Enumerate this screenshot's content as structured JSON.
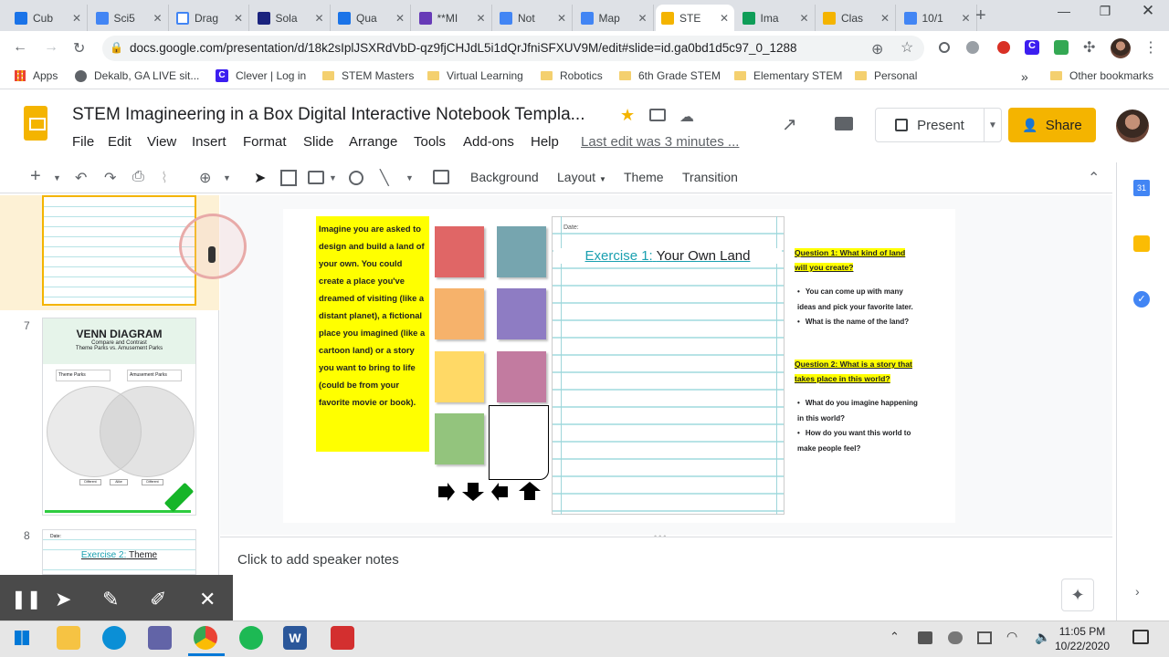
{
  "browser": {
    "tabs": [
      {
        "label": "Cub",
        "color": "#1a73e8",
        "icon": "docs-icon"
      },
      {
        "label": "Sci5",
        "color": "#4285f4",
        "icon": "docs-icon"
      },
      {
        "label": "Drag",
        "color": "#ffffff",
        "icon": "google-icon"
      },
      {
        "label": "Sola",
        "color": "#1a237e",
        "icon": "eu-flag-icon"
      },
      {
        "label": "Qua",
        "color": "#1a73e8",
        "icon": "portrait-icon"
      },
      {
        "label": "**MI",
        "color": "#673ab7",
        "icon": "forms-icon"
      },
      {
        "label": "Not",
        "color": "#4285f4",
        "icon": "docs-icon"
      },
      {
        "label": "Map",
        "color": "#4285f4",
        "icon": "docs-icon"
      },
      {
        "label": "STE",
        "color": "#f4b400",
        "icon": "slides-icon"
      },
      {
        "label": "Ima",
        "color": "#0f9d58",
        "icon": "check-icon"
      },
      {
        "label": "Clas",
        "color": "#f4b400",
        "icon": "classroom-icon"
      },
      {
        "label": "10/1",
        "color": "#4285f4",
        "icon": "docs-icon"
      }
    ],
    "url": "docs.google.com/presentation/d/18k2sIplJSXRdVbD-qz9fjCHJdL5i1dQrJfniSFXUV9M/edit#slide=id.ga0bd1d5c97_0_1288",
    "bookmarks": [
      "Apps",
      "Dekalb, GA LIVE sit...",
      "Clever | Log in",
      "STEM Masters",
      "Virtual Learning",
      "Robotics",
      "6th Grade STEM",
      "Elementary STEM",
      "Personal"
    ],
    "other_bookmarks": "Other bookmarks",
    "overflow": "»"
  },
  "doc": {
    "title": "STEM Imagineering in a Box Digital Interactive Notebook Templa...",
    "menus": [
      "File",
      "Edit",
      "View",
      "Insert",
      "Format",
      "Slide",
      "Arrange",
      "Tools",
      "Add-ons",
      "Help"
    ],
    "last_edit": "Last edit was 3 minutes ...",
    "present": "Present",
    "share": "Share"
  },
  "toolbar": {
    "background": "Background",
    "layout": "Layout",
    "theme": "Theme",
    "transition": "Transition"
  },
  "filmstrip": {
    "slide7_num": "7",
    "slide7_title": "Venn Diagram",
    "slide7_sub1": "Compare and Contrast",
    "slide7_sub2": "Theme Parks vs. Amusement Parks",
    "slide7_label1": "Theme Parks",
    "slide7_label2": "Amusement Parks",
    "slide7_boxes": [
      "Different",
      "Alike",
      "Different"
    ],
    "slide8_num": "8",
    "slide8_date": "Date:",
    "slide8_title_a": "Exercise 2:",
    "slide8_title_b": "Theme"
  },
  "slide": {
    "prompt": "Imagine you are asked to design and build a land of your own. You could create a place you've dreamed of visiting (like a distant planet), a fictional place you imagined (like a cartoon land) or a story you want to bring to life (could be from your favorite movie or book).",
    "stickies": [
      "#e06666",
      "#76a5af",
      "#f6b26b",
      "#8e7cc3",
      "#ffd966",
      "#c27ba0",
      "#93c47d"
    ],
    "date": "Date:",
    "exercise_a": "Exercise 1:",
    "exercise_b": "Your Own Land",
    "q1": "Question 1: What kind of land will you create?",
    "q1_bullets": [
      "You can come up with many ideas and pick your favorite later.",
      "What is the name of the land?"
    ],
    "q2": "Question 2: What is a story that takes place in this world?",
    "q2_bullets": [
      "What do you imagine happening in this world?",
      "How do you want this world to make people feel?"
    ]
  },
  "notes": {
    "placeholder": "Click to add speaker notes"
  },
  "taskbar": {
    "time": "11:05 PM",
    "date": "10/22/2020"
  }
}
